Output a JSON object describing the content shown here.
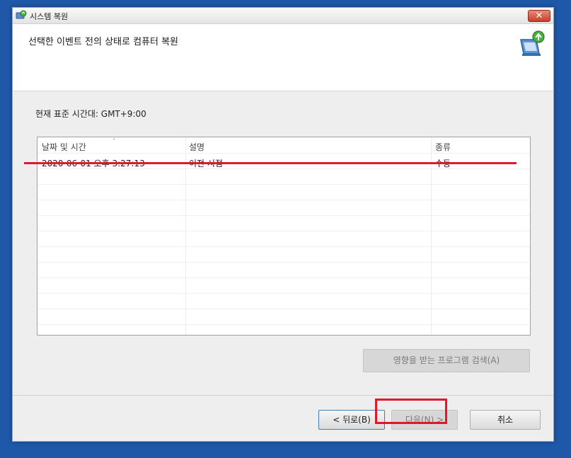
{
  "window": {
    "title": "시스템 복원",
    "close_label": "✕"
  },
  "header": {
    "title": "선택한 이벤트 전의 상태로 컴퓨터 복원",
    "icon": "system-restore-icon"
  },
  "timezone_label": "현재 표준 시간대: GMT+9:00",
  "table": {
    "columns": [
      "날짜 및 시간",
      "설명",
      "종류"
    ],
    "sort_indicator": "ˇ",
    "rows": [
      [
        "2020-06-01 오후 3:27:13",
        "이전 시점",
        "수동"
      ]
    ]
  },
  "buttons": {
    "scan_label": "영향을 받는 프로그램 검색(A)",
    "back_label": "< 뒤로(B)",
    "next_label": "다음(N) >",
    "cancel_label": "취소"
  },
  "colors": {
    "highlight": "#e0182c",
    "desktop": "#1f58a8"
  }
}
